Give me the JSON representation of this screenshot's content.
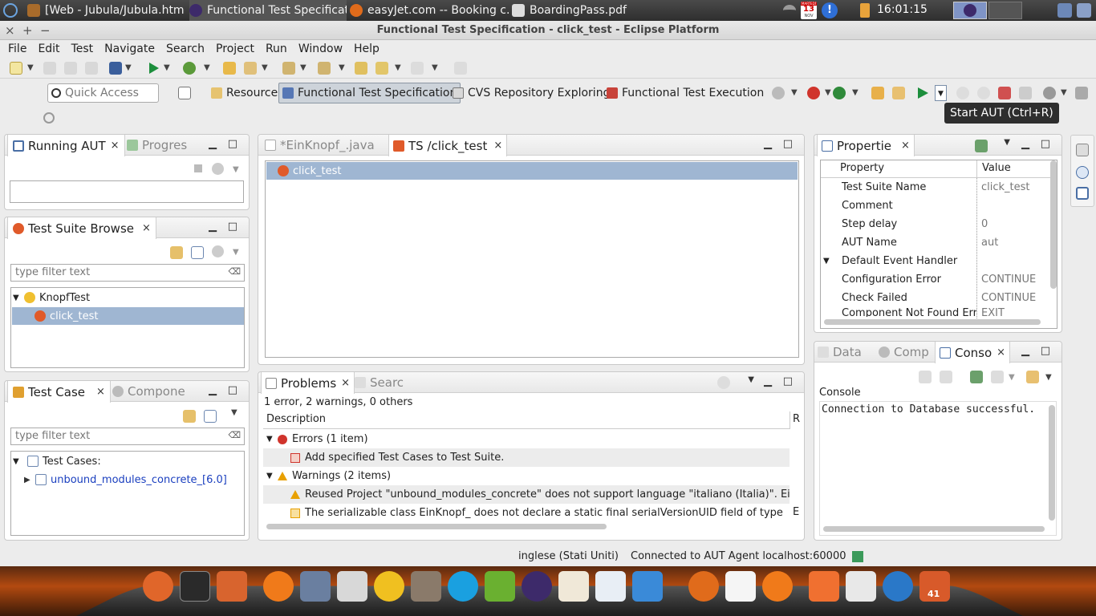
{
  "topbar": {
    "tasks": [
      "[Web - Jubula/Jubula.htm...",
      "Functional Test Specificat...",
      "easyJet.com -- Booking c...",
      "BoardingPass.pdf"
    ],
    "calendar_month": "MARTEDÌ",
    "calendar_day": "13",
    "calendar_sub": "NOV",
    "clock": "16:01:15"
  },
  "window": {
    "title": "Functional Test Specification - click_test - Eclipse Platform",
    "controls": [
      "×",
      "+",
      "−"
    ]
  },
  "menu": [
    "File",
    "Edit",
    "Test",
    "Navigate",
    "Search",
    "Project",
    "Run",
    "Window",
    "Help"
  ],
  "toolbar": {
    "quick_access_placeholder": "Quick Access",
    "perspectives": [
      "Resource",
      "Functional Test Specification",
      "CVS Repository Exploring",
      "Functional Test Execution"
    ],
    "tooltip": "Start AUT (Ctrl+R)"
  },
  "running_aut": {
    "tabs": [
      "Running AUT",
      "Progres"
    ]
  },
  "ts_browser": {
    "title": "Test Suite Browse",
    "filter_placeholder": "type filter text",
    "tree": [
      {
        "label": "KnopfTest",
        "expanded": "▼"
      },
      {
        "label": "click_test",
        "selected": true
      }
    ]
  },
  "test_case": {
    "tabs": [
      "Test Case",
      "Compone"
    ],
    "filter_placeholder": "type filter text",
    "tree": [
      {
        "label": "Test Cases:",
        "arrow": "▼"
      },
      {
        "label": "unbound_modules_concrete_[6.0]",
        "arrow": "▶"
      }
    ]
  },
  "editor": {
    "tabs": [
      "*EinKnopf_.java",
      "TS /click_test"
    ],
    "row": "click_test"
  },
  "problems": {
    "tabs": [
      "Problems",
      "Searc"
    ],
    "summary": "1 error, 2 warnings, 0 others",
    "col_description": "Description",
    "col_r": "R",
    "rows": [
      {
        "arrow": "▼",
        "text": "Errors (1 item)"
      },
      {
        "text": "Add specified Test Cases to Test Suite."
      },
      {
        "arrow": "▼",
        "text": "Warnings (2 items)"
      },
      {
        "text": "Reused Project \"unbound_modules_concrete\" does not support language \"italiano (Italia)\". Ei"
      },
      {
        "text": "The serializable class EinKnopf_ does not declare a static final serialVersionUID field of type",
        "tail": "E"
      }
    ]
  },
  "properties": {
    "title": "Propertie",
    "col_property": "Property",
    "col_value": "Value",
    "rows": [
      {
        "name": "Test Suite Name",
        "value": "click_test"
      },
      {
        "name": "Comment",
        "value": ""
      },
      {
        "name": "Step delay",
        "value": "0"
      },
      {
        "name": "AUT Name",
        "value": "aut"
      },
      {
        "name": "Default Event Handler",
        "value": "",
        "arrow": "▼"
      },
      {
        "name": "Configuration Error",
        "value": "CONTINUE"
      },
      {
        "name": "Check Failed",
        "value": "CONTINUE"
      },
      {
        "name": "Component Not Found Err",
        "value": "EXIT"
      }
    ]
  },
  "console": {
    "tabs": [
      "Data",
      "Comp",
      "Conso"
    ],
    "label": "Console",
    "text": "Connection to Database successful."
  },
  "status": {
    "language": "inglese (Stati Uniti)",
    "connection": "Connected to AUT Agent localhost:60000"
  },
  "dock": {
    "badge": "41"
  },
  "colors": {
    "selection": "#9fb6d2",
    "link": "#1a3fbf",
    "error": "#d0342c",
    "warning": "#e8a000"
  }
}
